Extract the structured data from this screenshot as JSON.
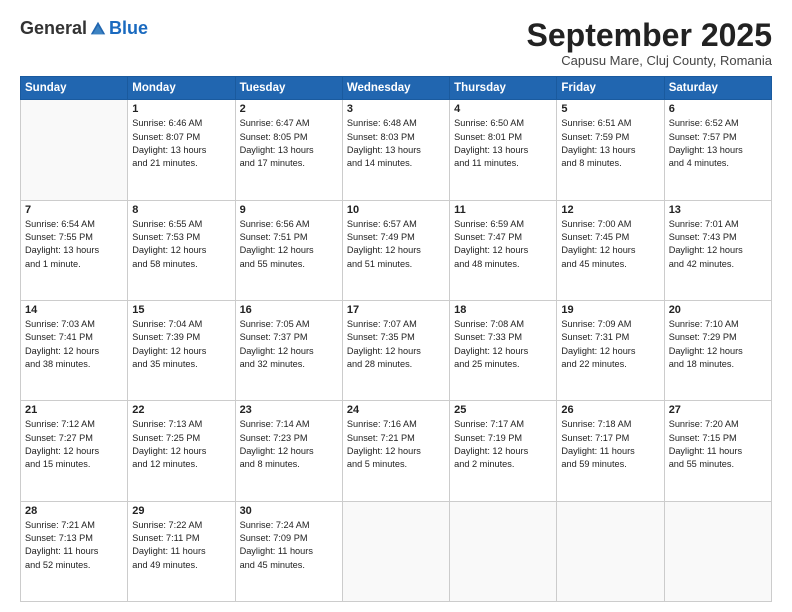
{
  "header": {
    "logo_general": "General",
    "logo_blue": "Blue",
    "month_title": "September 2025",
    "location": "Capusu Mare, Cluj County, Romania"
  },
  "weekdays": [
    "Sunday",
    "Monday",
    "Tuesday",
    "Wednesday",
    "Thursday",
    "Friday",
    "Saturday"
  ],
  "weeks": [
    [
      {
        "day": "",
        "info": ""
      },
      {
        "day": "1",
        "info": "Sunrise: 6:46 AM\nSunset: 8:07 PM\nDaylight: 13 hours\nand 21 minutes."
      },
      {
        "day": "2",
        "info": "Sunrise: 6:47 AM\nSunset: 8:05 PM\nDaylight: 13 hours\nand 17 minutes."
      },
      {
        "day": "3",
        "info": "Sunrise: 6:48 AM\nSunset: 8:03 PM\nDaylight: 13 hours\nand 14 minutes."
      },
      {
        "day": "4",
        "info": "Sunrise: 6:50 AM\nSunset: 8:01 PM\nDaylight: 13 hours\nand 11 minutes."
      },
      {
        "day": "5",
        "info": "Sunrise: 6:51 AM\nSunset: 7:59 PM\nDaylight: 13 hours\nand 8 minutes."
      },
      {
        "day": "6",
        "info": "Sunrise: 6:52 AM\nSunset: 7:57 PM\nDaylight: 13 hours\nand 4 minutes."
      }
    ],
    [
      {
        "day": "7",
        "info": "Sunrise: 6:54 AM\nSunset: 7:55 PM\nDaylight: 13 hours\nand 1 minute."
      },
      {
        "day": "8",
        "info": "Sunrise: 6:55 AM\nSunset: 7:53 PM\nDaylight: 12 hours\nand 58 minutes."
      },
      {
        "day": "9",
        "info": "Sunrise: 6:56 AM\nSunset: 7:51 PM\nDaylight: 12 hours\nand 55 minutes."
      },
      {
        "day": "10",
        "info": "Sunrise: 6:57 AM\nSunset: 7:49 PM\nDaylight: 12 hours\nand 51 minutes."
      },
      {
        "day": "11",
        "info": "Sunrise: 6:59 AM\nSunset: 7:47 PM\nDaylight: 12 hours\nand 48 minutes."
      },
      {
        "day": "12",
        "info": "Sunrise: 7:00 AM\nSunset: 7:45 PM\nDaylight: 12 hours\nand 45 minutes."
      },
      {
        "day": "13",
        "info": "Sunrise: 7:01 AM\nSunset: 7:43 PM\nDaylight: 12 hours\nand 42 minutes."
      }
    ],
    [
      {
        "day": "14",
        "info": "Sunrise: 7:03 AM\nSunset: 7:41 PM\nDaylight: 12 hours\nand 38 minutes."
      },
      {
        "day": "15",
        "info": "Sunrise: 7:04 AM\nSunset: 7:39 PM\nDaylight: 12 hours\nand 35 minutes."
      },
      {
        "day": "16",
        "info": "Sunrise: 7:05 AM\nSunset: 7:37 PM\nDaylight: 12 hours\nand 32 minutes."
      },
      {
        "day": "17",
        "info": "Sunrise: 7:07 AM\nSunset: 7:35 PM\nDaylight: 12 hours\nand 28 minutes."
      },
      {
        "day": "18",
        "info": "Sunrise: 7:08 AM\nSunset: 7:33 PM\nDaylight: 12 hours\nand 25 minutes."
      },
      {
        "day": "19",
        "info": "Sunrise: 7:09 AM\nSunset: 7:31 PM\nDaylight: 12 hours\nand 22 minutes."
      },
      {
        "day": "20",
        "info": "Sunrise: 7:10 AM\nSunset: 7:29 PM\nDaylight: 12 hours\nand 18 minutes."
      }
    ],
    [
      {
        "day": "21",
        "info": "Sunrise: 7:12 AM\nSunset: 7:27 PM\nDaylight: 12 hours\nand 15 minutes."
      },
      {
        "day": "22",
        "info": "Sunrise: 7:13 AM\nSunset: 7:25 PM\nDaylight: 12 hours\nand 12 minutes."
      },
      {
        "day": "23",
        "info": "Sunrise: 7:14 AM\nSunset: 7:23 PM\nDaylight: 12 hours\nand 8 minutes."
      },
      {
        "day": "24",
        "info": "Sunrise: 7:16 AM\nSunset: 7:21 PM\nDaylight: 12 hours\nand 5 minutes."
      },
      {
        "day": "25",
        "info": "Sunrise: 7:17 AM\nSunset: 7:19 PM\nDaylight: 12 hours\nand 2 minutes."
      },
      {
        "day": "26",
        "info": "Sunrise: 7:18 AM\nSunset: 7:17 PM\nDaylight: 11 hours\nand 59 minutes."
      },
      {
        "day": "27",
        "info": "Sunrise: 7:20 AM\nSunset: 7:15 PM\nDaylight: 11 hours\nand 55 minutes."
      }
    ],
    [
      {
        "day": "28",
        "info": "Sunrise: 7:21 AM\nSunset: 7:13 PM\nDaylight: 11 hours\nand 52 minutes."
      },
      {
        "day": "29",
        "info": "Sunrise: 7:22 AM\nSunset: 7:11 PM\nDaylight: 11 hours\nand 49 minutes."
      },
      {
        "day": "30",
        "info": "Sunrise: 7:24 AM\nSunset: 7:09 PM\nDaylight: 11 hours\nand 45 minutes."
      },
      {
        "day": "",
        "info": ""
      },
      {
        "day": "",
        "info": ""
      },
      {
        "day": "",
        "info": ""
      },
      {
        "day": "",
        "info": ""
      }
    ]
  ]
}
